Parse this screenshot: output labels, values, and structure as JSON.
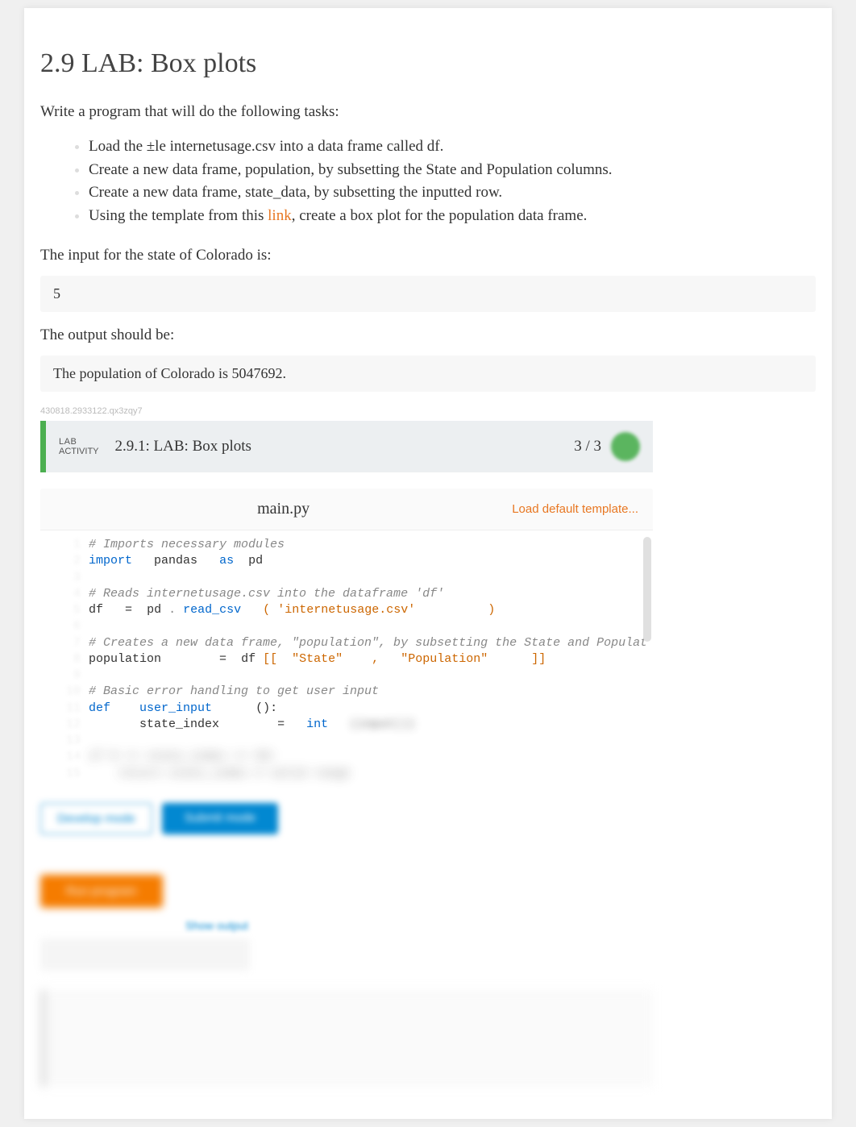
{
  "title": "2.9 LAB: Box plots",
  "intro": "Write a program that will do the following tasks:",
  "tasks": [
    "Load the ±le internetusage.csv into a data frame called df.",
    "Create a new data frame, population, by subsetting the State and Population columns.",
    "Create a new data frame, state_data, by subsetting the inputted row.",
    "Using the template from this "
  ],
  "task4_link": "link",
  "task4_rest": ", create a box plot for the population data frame.",
  "input_label": "The input for the state of Colorado is:",
  "input_value": "5",
  "output_label": "The output should be:",
  "output_value": "The population of Colorado is 5047692.",
  "tiny_id": "430818.2933122.qx3zqy7",
  "lab": {
    "tag1": "LAB",
    "tag2": "ACTIVITY",
    "title": "2.9.1: LAB: Box plots",
    "score": "3 / 3"
  },
  "editor": {
    "filename": "main.py",
    "load_template": "Load default template..."
  },
  "code": {
    "l1": "# Imports necessary modules",
    "l2_import": "import",
    "l2_pandas": "pandas",
    "l2_as": "as",
    "l2_pd": "pd",
    "l4": "# Reads internetusage.csv into the dataframe 'df'",
    "l5_df": "df",
    "l5_eq": "=",
    "l5_pd": "pd",
    "l5_dot": ".",
    "l5_read": "read_csv",
    "l5_paren_open": "(",
    "l5_str": "'internetusage.csv'",
    "l5_paren_close": ")",
    "l7": "# Creates a new data frame, \"population\", by subsetting the State and Populat",
    "l8_pop": "population",
    "l8_eq": "=",
    "l8_df": "df",
    "l8_open": "[[",
    "l8_state": "\"State\"",
    "l8_comma": ",",
    "l8_popu": "\"Population\"",
    "l8_close": "]]",
    "l10": "# Basic error handling to get user input",
    "l11_def": "def",
    "l11_fn": "user_input",
    "l11_paren": "():",
    "l12_var": "state_index",
    "l12_eq": "=",
    "l12_int": "int",
    "l12_blur": "(input())",
    "l13_blur": "if 0 <= state_index <= 50:",
    "l14_blur": "    return state_index # valid range"
  },
  "buttons": {
    "develop": "Develop mode",
    "submit": "Submit mode",
    "run": "Run program",
    "only": "Show output"
  }
}
